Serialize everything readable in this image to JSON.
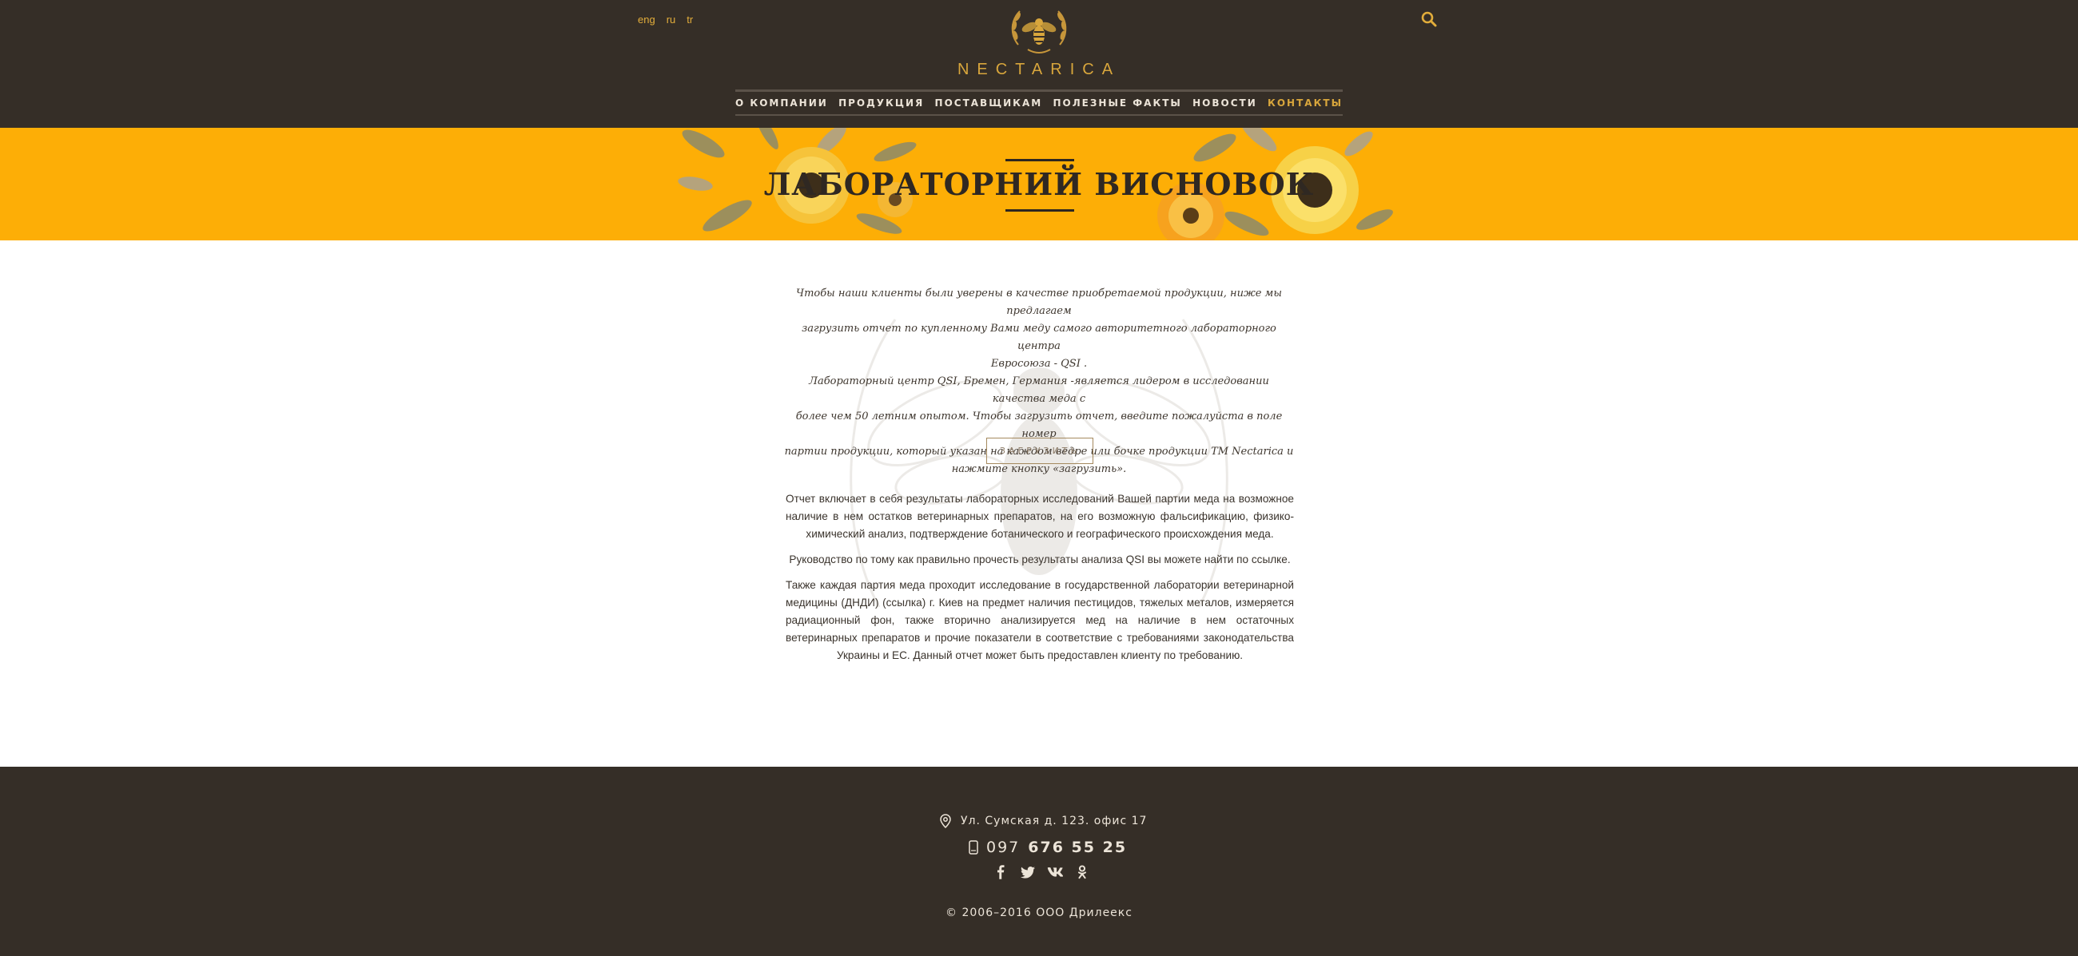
{
  "header": {
    "languages": [
      "eng",
      "ru",
      "tr"
    ],
    "brand": "NECTARICA",
    "nav": [
      {
        "label": "О КОМПАНИИ"
      },
      {
        "label": "ПРОДУКЦИЯ"
      },
      {
        "label": "ПОСТАВЩИКАМ"
      },
      {
        "label": "ПОЛЕЗНЫЕ ФАКТЫ"
      },
      {
        "label": "НОВОСТИ"
      },
      {
        "label": "КОНТАКТЫ"
      }
    ],
    "active_nav": "КОНТАКТЫ"
  },
  "banner": {
    "title": "ЛАБОРАТОРНИЙ ВИСНОВОК"
  },
  "content": {
    "intro_lines": [
      "Чтобы наши клиенты были уверены в качестве приобретаемой продукции, ниже мы предлагаем",
      "загрузить отчет по купленному Вами меду самого авторитетного лабораторного центра",
      "Евросоюза - QSI .",
      "Лабораторный центр QSI, Бремен, Германия -является лидером в исследовании качества меда с",
      "более чем 50 летним опытом. Чтобы загрузить отчет, введите пожалуйста в поле номер",
      "партии продукции, который указан на каждом ведре или бочке продукции ТМ Nectarica и",
      "нажмите кнопку «загрузить»."
    ],
    "load_button": "ЗАГРУЗИТЬ",
    "paragraph_1": "Отчет включает в себя результаты лабораторных исследований Вашей партии меда на возможное наличие в нем остатков ветеринарных препаратов, на его возможную фальсификацию, физико-химический анализ, подтверждение ботанического и географического происхождения меда.",
    "paragraph_2": "Руководство по тому как правильно прочесть результаты анализа QSI вы можете найти по ссылке.",
    "paragraph_3": "Также каждая партия меда проходит исследование в государственной лаборатории ветеринарной медицины (ДНДИ) (ссылка) г. Киев на предмет наличия пестицидов, тяжелых металов, измеряется радиационный фон, также вторично анализируется мед на наличие в нем остаточных ветеринарных препаратов и прочие показатели в соответствие с требованиями законодательства Украины и ЕС. Данный отчет может быть предоставлен клиенту по требованию."
  },
  "footer": {
    "address": "Ул. Сумская д. 123. офис 17",
    "phone_prefix": "097",
    "phone_number": "676 55 25",
    "socials": [
      "facebook-icon",
      "twitter-icon",
      "vk-icon",
      "odnoklassniki-icon"
    ],
    "copyright": "© 2006–2016 ООО Дрилеекс"
  },
  "colors": {
    "header_bg": "#352e27",
    "accent_gold": "#d8a63c",
    "banner_yellow": "#fdae06",
    "text_dark": "#3b342d"
  }
}
